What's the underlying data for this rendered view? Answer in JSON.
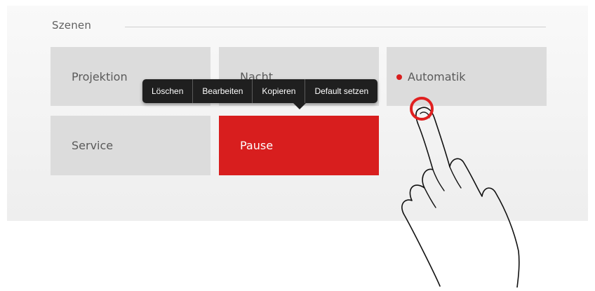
{
  "section": {
    "title": "Szenen"
  },
  "tiles": [
    {
      "label": "Projektion",
      "active": false
    },
    {
      "label": "Nacht",
      "active": false
    },
    {
      "label": "Automatik",
      "active": false,
      "indicator": true
    },
    {
      "label": "Service",
      "active": false
    },
    {
      "label": "Pause",
      "active": true
    }
  ],
  "context_menu": {
    "items": [
      "Löschen",
      "Bearbeiten",
      "Kopieren",
      "Default setzen"
    ]
  },
  "colors": {
    "accent": "#d81e1e",
    "tile": "#dcdcdc",
    "menu": "#1f1f1f"
  },
  "icons": {
    "touch": "touch-indicator-icon",
    "hand": "pointing-hand-icon"
  }
}
